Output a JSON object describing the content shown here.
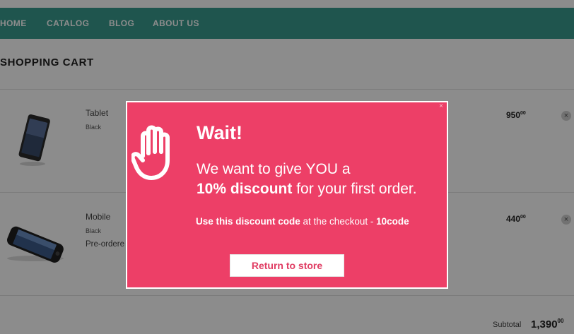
{
  "nav": {
    "items": [
      "HOME",
      "CATALOG",
      "BLOG",
      "ABOUT US"
    ]
  },
  "page": {
    "title": "SHOPPING CART"
  },
  "cart": {
    "items": [
      {
        "name": "Tablet",
        "variant": "Black",
        "note": "",
        "price": "950",
        "price_cents": "00"
      },
      {
        "name": "Mobile",
        "variant": "Black",
        "note": "Pre-ordere",
        "price": "440",
        "price_cents": "00"
      }
    ],
    "subtotal_label": "Subtotal",
    "subtotal_value": "1,390",
    "subtotal_cents": "00"
  },
  "modal": {
    "close": "×",
    "title": "Wait!",
    "line1": "We want to give YOU a",
    "line2_bold": "10% discount",
    "line2_rest": " for your first order.",
    "code_prefix": "Use this discount code",
    "code_middle": " at the checkout - ",
    "code_value": "10code",
    "button": "Return to store"
  },
  "colors": {
    "nav": "#3a9b8f",
    "modal": "#ed3f67",
    "button_text": "#e03c63"
  }
}
